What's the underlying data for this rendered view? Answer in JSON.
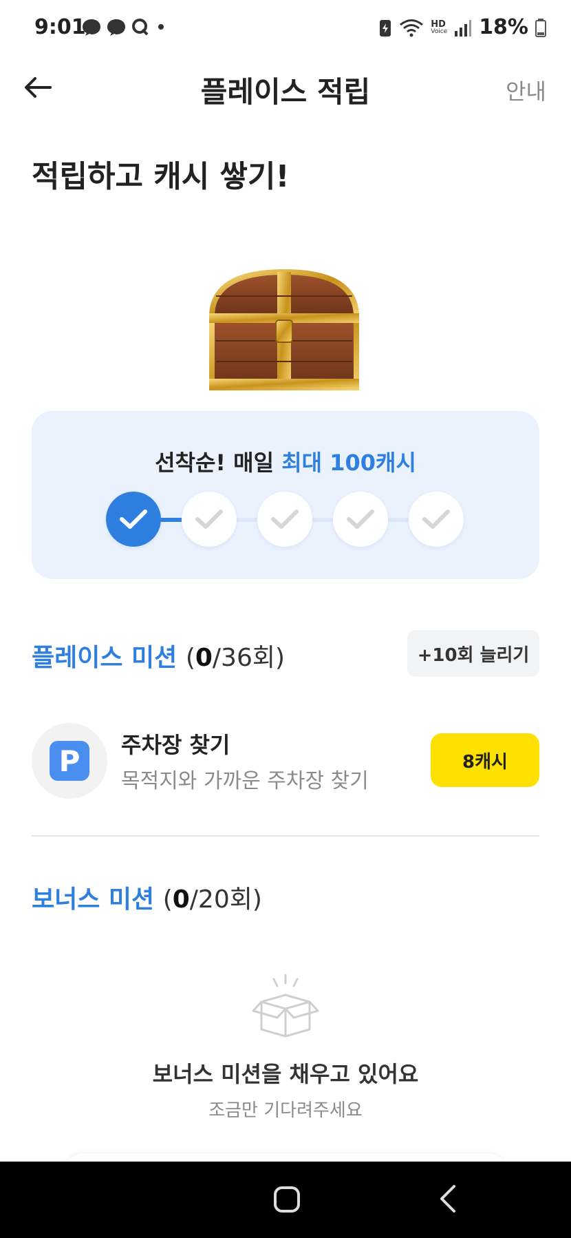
{
  "status_bar": {
    "time": "9:01",
    "left_icons": [
      "chat-bubble-icon",
      "chat-bubble-icon",
      "q-icon",
      "dot-icon"
    ],
    "right_icons": [
      "battery-saver-icon",
      "wifi-icon",
      "hd-voice-icon",
      "signal-icon",
      "battery-icon"
    ],
    "hd_label": "HD",
    "voice_label": "Voice",
    "battery_percent": "18%"
  },
  "header": {
    "title": "플레이스 적립",
    "guide_label": "안내"
  },
  "hero": {
    "title": "적립하고 캐시 쌓기!"
  },
  "progress": {
    "text_prefix": "선착순! 매일 ",
    "text_accent": "최대 100캐시",
    "total_steps": 5,
    "completed_steps": 1,
    "accent_color": "#2f7fe0"
  },
  "place_mission": {
    "title": "플레이스 미션",
    "count_done": "0",
    "count_total": "/36회",
    "extend_label": "+10회 늘리기",
    "items": [
      {
        "icon_letter": "P",
        "name": "주차장 찾기",
        "description": "목적지와 가까운 주차장 찾기",
        "reward": "8캐시"
      }
    ]
  },
  "bonus_mission": {
    "title": "보너스 미션",
    "count_done": "0",
    "count_total": "/20회",
    "empty_title": "보너스 미션을 채우고 있어요",
    "empty_subtitle": "조금만 기다려주세요"
  }
}
